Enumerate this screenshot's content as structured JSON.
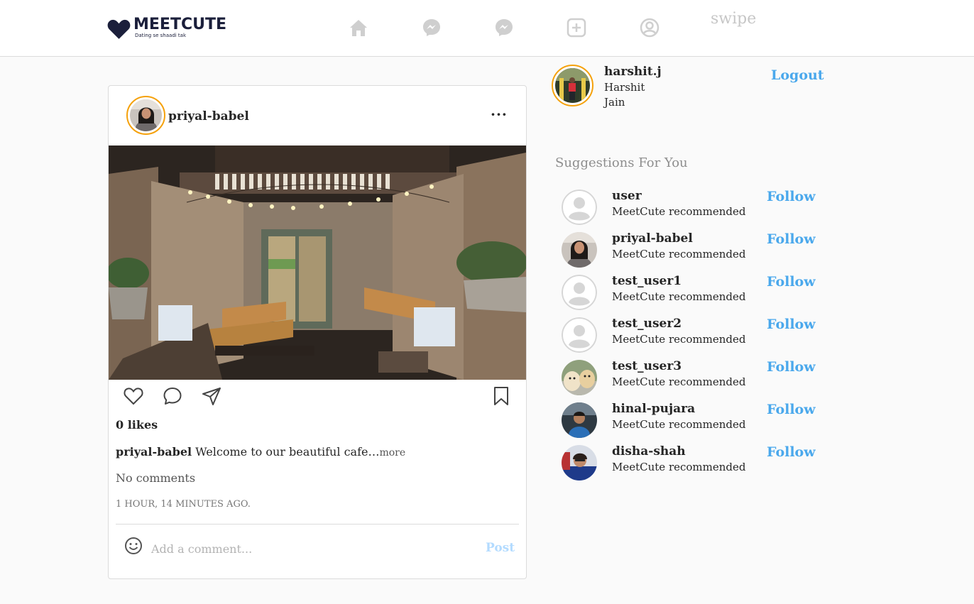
{
  "brand": {
    "name": "MEETCUTE",
    "tagline": "Dating se shaadi tak"
  },
  "nav": {
    "items": [
      "home-icon",
      "messenger-icon",
      "messenger-icon",
      "add-post-icon",
      "profile-icon"
    ],
    "swipe_label": "swipe"
  },
  "post": {
    "username": "priyal-babel",
    "menu": "···",
    "likes": "0 likes",
    "caption_user": "priyal-babel",
    "caption_text": " Welcome to our beautiful cafe…",
    "caption_more": "more",
    "comments": "No comments",
    "time": "1 HOUR, 14 MINUTES AGO.",
    "comment_placeholder": "Add a comment...",
    "post_label": "Post"
  },
  "me": {
    "username": "harshit.j",
    "first_name": "Harshit",
    "last_name": "Jain",
    "logout_label": "Logout"
  },
  "suggestions": {
    "title": "Suggestions For You",
    "items": [
      {
        "username": "user",
        "subtitle": "MeetCute recommended",
        "follow": "Follow",
        "avatar": "default"
      },
      {
        "username": "priyal-babel",
        "subtitle": "MeetCute recommended",
        "follow": "Follow",
        "avatar": "photo-woman"
      },
      {
        "username": "test_user1",
        "subtitle": "MeetCute recommended",
        "follow": "Follow",
        "avatar": "default"
      },
      {
        "username": "test_user2",
        "subtitle": "MeetCute recommended",
        "follow": "Follow",
        "avatar": "default"
      },
      {
        "username": "test_user3",
        "subtitle": "MeetCute recommended",
        "follow": "Follow",
        "avatar": "photo-puppies"
      },
      {
        "username": "hinal-pujara",
        "subtitle": "MeetCute recommended",
        "follow": "Follow",
        "avatar": "photo-person"
      },
      {
        "username": "disha-shah",
        "subtitle": "MeetCute recommended",
        "follow": "Follow",
        "avatar": "photo-person"
      }
    ]
  },
  "colors": {
    "accent": "#4aa8ec",
    "story_ring": "#f5a10b",
    "brand": "#1b1f3b",
    "post_button": "#b3dbff"
  }
}
